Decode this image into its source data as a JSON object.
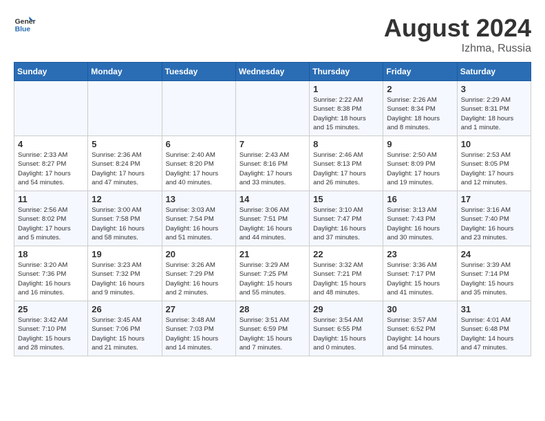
{
  "logo": {
    "line1": "General",
    "line2": "Blue"
  },
  "title": "August 2024",
  "location": "Izhma, Russia",
  "days_of_week": [
    "Sunday",
    "Monday",
    "Tuesday",
    "Wednesday",
    "Thursday",
    "Friday",
    "Saturday"
  ],
  "weeks": [
    [
      {
        "num": "",
        "info": ""
      },
      {
        "num": "",
        "info": ""
      },
      {
        "num": "",
        "info": ""
      },
      {
        "num": "",
        "info": ""
      },
      {
        "num": "1",
        "info": "Sunrise: 2:22 AM\nSunset: 8:38 PM\nDaylight: 18 hours\nand 15 minutes."
      },
      {
        "num": "2",
        "info": "Sunrise: 2:26 AM\nSunset: 8:34 PM\nDaylight: 18 hours\nand 8 minutes."
      },
      {
        "num": "3",
        "info": "Sunrise: 2:29 AM\nSunset: 8:31 PM\nDaylight: 18 hours\nand 1 minute."
      }
    ],
    [
      {
        "num": "4",
        "info": "Sunrise: 2:33 AM\nSunset: 8:27 PM\nDaylight: 17 hours\nand 54 minutes."
      },
      {
        "num": "5",
        "info": "Sunrise: 2:36 AM\nSunset: 8:24 PM\nDaylight: 17 hours\nand 47 minutes."
      },
      {
        "num": "6",
        "info": "Sunrise: 2:40 AM\nSunset: 8:20 PM\nDaylight: 17 hours\nand 40 minutes."
      },
      {
        "num": "7",
        "info": "Sunrise: 2:43 AM\nSunset: 8:16 PM\nDaylight: 17 hours\nand 33 minutes."
      },
      {
        "num": "8",
        "info": "Sunrise: 2:46 AM\nSunset: 8:13 PM\nDaylight: 17 hours\nand 26 minutes."
      },
      {
        "num": "9",
        "info": "Sunrise: 2:50 AM\nSunset: 8:09 PM\nDaylight: 17 hours\nand 19 minutes."
      },
      {
        "num": "10",
        "info": "Sunrise: 2:53 AM\nSunset: 8:05 PM\nDaylight: 17 hours\nand 12 minutes."
      }
    ],
    [
      {
        "num": "11",
        "info": "Sunrise: 2:56 AM\nSunset: 8:02 PM\nDaylight: 17 hours\nand 5 minutes."
      },
      {
        "num": "12",
        "info": "Sunrise: 3:00 AM\nSunset: 7:58 PM\nDaylight: 16 hours\nand 58 minutes."
      },
      {
        "num": "13",
        "info": "Sunrise: 3:03 AM\nSunset: 7:54 PM\nDaylight: 16 hours\nand 51 minutes."
      },
      {
        "num": "14",
        "info": "Sunrise: 3:06 AM\nSunset: 7:51 PM\nDaylight: 16 hours\nand 44 minutes."
      },
      {
        "num": "15",
        "info": "Sunrise: 3:10 AM\nSunset: 7:47 PM\nDaylight: 16 hours\nand 37 minutes."
      },
      {
        "num": "16",
        "info": "Sunrise: 3:13 AM\nSunset: 7:43 PM\nDaylight: 16 hours\nand 30 minutes."
      },
      {
        "num": "17",
        "info": "Sunrise: 3:16 AM\nSunset: 7:40 PM\nDaylight: 16 hours\nand 23 minutes."
      }
    ],
    [
      {
        "num": "18",
        "info": "Sunrise: 3:20 AM\nSunset: 7:36 PM\nDaylight: 16 hours\nand 16 minutes."
      },
      {
        "num": "19",
        "info": "Sunrise: 3:23 AM\nSunset: 7:32 PM\nDaylight: 16 hours\nand 9 minutes."
      },
      {
        "num": "20",
        "info": "Sunrise: 3:26 AM\nSunset: 7:29 PM\nDaylight: 16 hours\nand 2 minutes."
      },
      {
        "num": "21",
        "info": "Sunrise: 3:29 AM\nSunset: 7:25 PM\nDaylight: 15 hours\nand 55 minutes."
      },
      {
        "num": "22",
        "info": "Sunrise: 3:32 AM\nSunset: 7:21 PM\nDaylight: 15 hours\nand 48 minutes."
      },
      {
        "num": "23",
        "info": "Sunrise: 3:36 AM\nSunset: 7:17 PM\nDaylight: 15 hours\nand 41 minutes."
      },
      {
        "num": "24",
        "info": "Sunrise: 3:39 AM\nSunset: 7:14 PM\nDaylight: 15 hours\nand 35 minutes."
      }
    ],
    [
      {
        "num": "25",
        "info": "Sunrise: 3:42 AM\nSunset: 7:10 PM\nDaylight: 15 hours\nand 28 minutes."
      },
      {
        "num": "26",
        "info": "Sunrise: 3:45 AM\nSunset: 7:06 PM\nDaylight: 15 hours\nand 21 minutes."
      },
      {
        "num": "27",
        "info": "Sunrise: 3:48 AM\nSunset: 7:03 PM\nDaylight: 15 hours\nand 14 minutes."
      },
      {
        "num": "28",
        "info": "Sunrise: 3:51 AM\nSunset: 6:59 PM\nDaylight: 15 hours\nand 7 minutes."
      },
      {
        "num": "29",
        "info": "Sunrise: 3:54 AM\nSunset: 6:55 PM\nDaylight: 15 hours\nand 0 minutes."
      },
      {
        "num": "30",
        "info": "Sunrise: 3:57 AM\nSunset: 6:52 PM\nDaylight: 14 hours\nand 54 minutes."
      },
      {
        "num": "31",
        "info": "Sunrise: 4:01 AM\nSunset: 6:48 PM\nDaylight: 14 hours\nand 47 minutes."
      }
    ]
  ]
}
